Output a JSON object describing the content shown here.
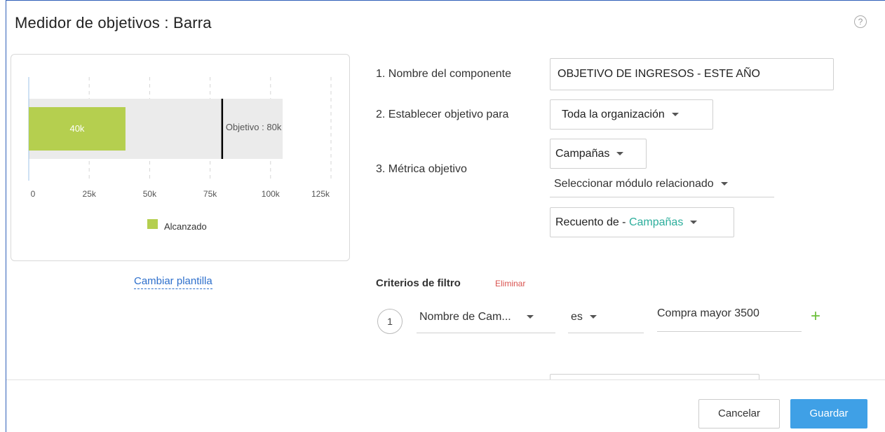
{
  "dialog": {
    "title": "Medidor de objetivos : Barra",
    "help_icon": "help-circle-icon"
  },
  "preview": {
    "change_template_label": "Cambiar plantilla"
  },
  "chart_data": {
    "type": "bar",
    "orientation": "horizontal",
    "categories": [
      ""
    ],
    "series": [
      {
        "name": "Alcanzado",
        "values": [
          40000
        ],
        "color": "#b5cf4f"
      }
    ],
    "value_label": "40k",
    "target": {
      "value": 80000,
      "label": "Objetivo : 80k"
    },
    "track_max": 105000,
    "xlim": [
      0,
      125000
    ],
    "xticks": [
      0,
      25000,
      50000,
      75000,
      100000,
      125000
    ],
    "xtick_labels": [
      "0",
      "25k",
      "50k",
      "75k",
      "100k",
      "125k"
    ],
    "grid": true,
    "legend": {
      "position": "bottom-center",
      "entries": [
        {
          "label": "Alcanzado",
          "color": "#b5cf4f"
        }
      ]
    }
  },
  "form": {
    "name": {
      "label": "1. Nombre del componente",
      "value": "OBJETIVO DE INGRESOS - ESTE AÑO"
    },
    "target_for": {
      "label": "2. Establecer objetivo para",
      "value": "Toda la organización"
    },
    "metric": {
      "label": "3. Métrica objetivo",
      "module": "Campañas",
      "related_module": "Seleccionar módulo relacionado",
      "aggregate_prefix": "Recuento de - ",
      "aggregate_field": "Campañas"
    }
  },
  "criteria": {
    "title": "Criterios de filtro",
    "delete_label": "Eliminar",
    "rows": [
      {
        "number": "1",
        "field": "Nombre de Cam...",
        "operator": "es",
        "value": "Compra mayor 3500"
      }
    ],
    "add_icon": "plus-icon"
  },
  "footer": {
    "cancel_label": "Cancelar",
    "save_label": "Guardar"
  }
}
